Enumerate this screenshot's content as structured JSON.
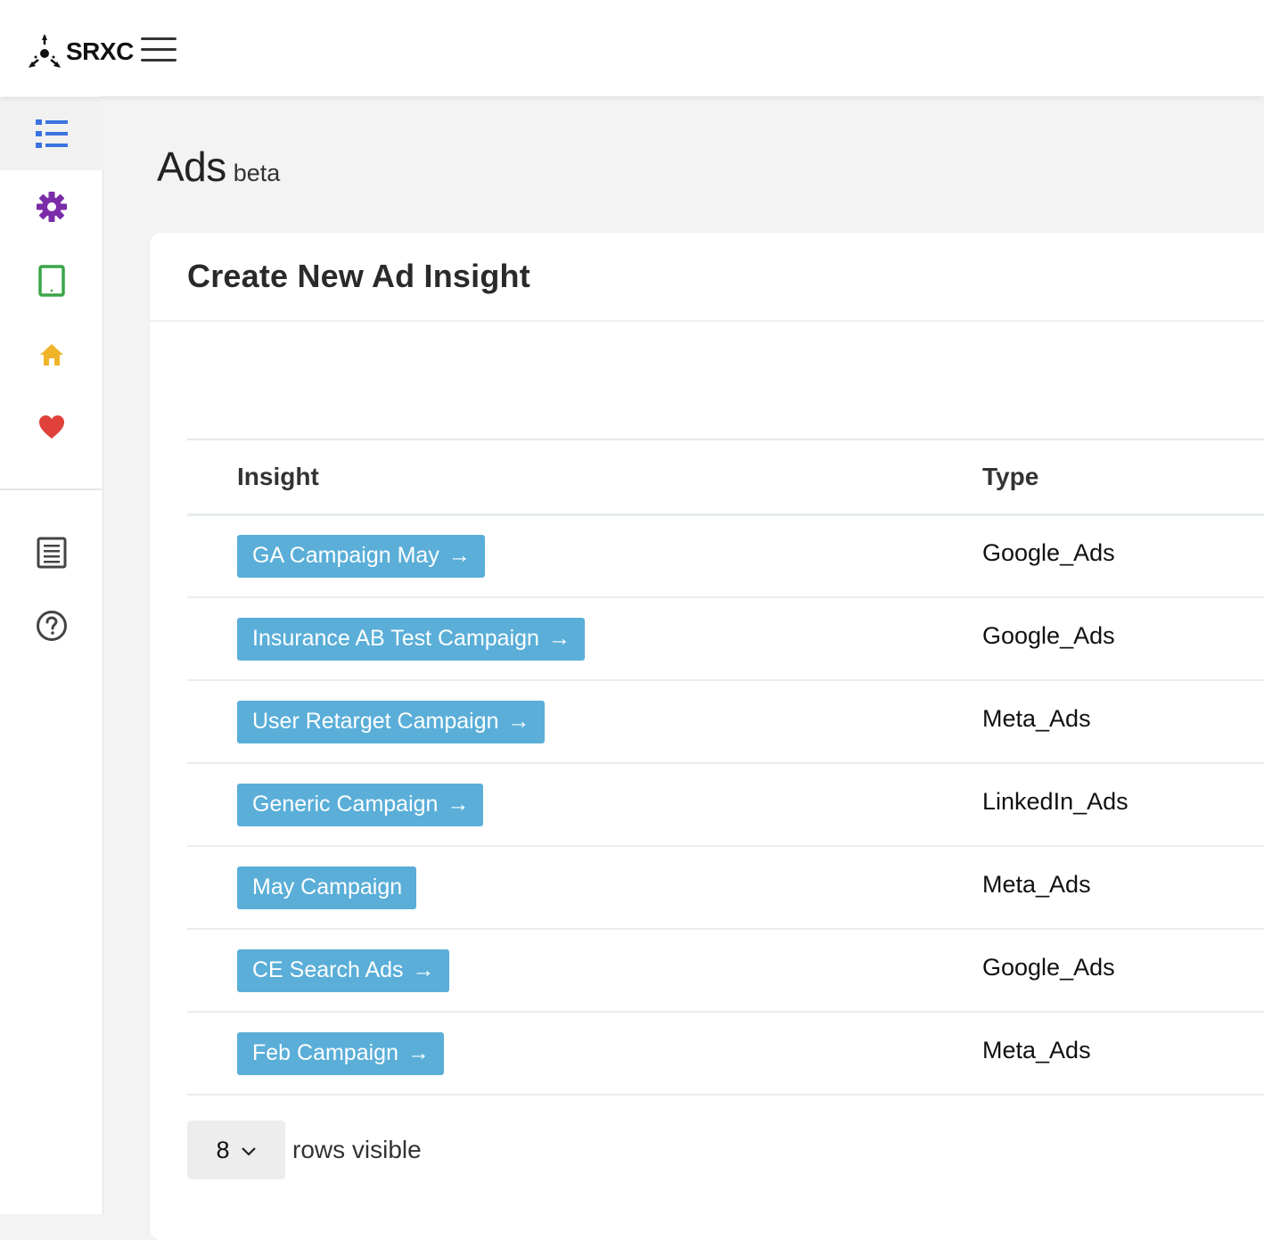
{
  "brand": {
    "name": "SRXC"
  },
  "sidebar": {
    "items": [
      {
        "icon": "list-icon",
        "color": "#3b73e0",
        "active": true
      },
      {
        "icon": "gear-icon",
        "color": "#7b2ca8"
      },
      {
        "icon": "tablet-icon",
        "color": "#3aa548"
      },
      {
        "icon": "home-icon",
        "color": "#f0b429"
      },
      {
        "icon": "heart-icon",
        "color": "#e0413a"
      },
      {
        "icon": "document-icon",
        "color": "#444444"
      },
      {
        "icon": "help-icon",
        "color": "#444444"
      }
    ]
  },
  "page": {
    "title": "Ads",
    "subtitle": "beta"
  },
  "card": {
    "title": "Create New Ad Insight"
  },
  "table": {
    "headers": {
      "insight": "Insight",
      "type": "Type"
    },
    "rows": [
      {
        "insight": "GA Campaign May",
        "arrow": "→",
        "type": "Google_Ads"
      },
      {
        "insight": "Insurance AB Test Campaign",
        "arrow": "→",
        "type": "Google_Ads"
      },
      {
        "insight": "User Retarget Campaign",
        "arrow": "→",
        "type": "Meta_Ads"
      },
      {
        "insight": "Generic Campaign",
        "arrow": "→",
        "type": "LinkedIn_Ads"
      },
      {
        "insight": "May Campaign",
        "arrow": "",
        "type": "Meta_Ads"
      },
      {
        "insight": "CE Search Ads",
        "arrow": "→",
        "type": "Google_Ads"
      },
      {
        "insight": "Feb Campaign",
        "arrow": "→",
        "type": "Meta_Ads"
      }
    ]
  },
  "pagination": {
    "rows_value": "8",
    "rows_label": "rows visible"
  },
  "colors": {
    "button_bg": "#5aaed8"
  }
}
